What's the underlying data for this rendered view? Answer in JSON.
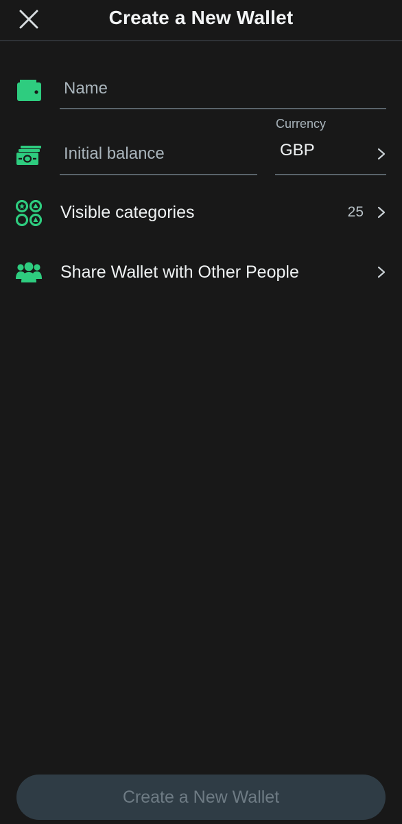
{
  "header": {
    "title": "Create a New Wallet"
  },
  "form": {
    "name_placeholder": "Name",
    "balance_placeholder": "Initial balance",
    "currency_label": "Currency",
    "currency_value": "GBP"
  },
  "rows": {
    "categories_label": "Visible categories",
    "categories_count": "25",
    "share_label": "Share Wallet with Other People"
  },
  "footer": {
    "create_button_label": "Create a New Wallet"
  },
  "colors": {
    "accent": "#2ecc7f",
    "background": "#181818",
    "button_bg": "#2f3c45",
    "button_text": "#6e7b84"
  }
}
